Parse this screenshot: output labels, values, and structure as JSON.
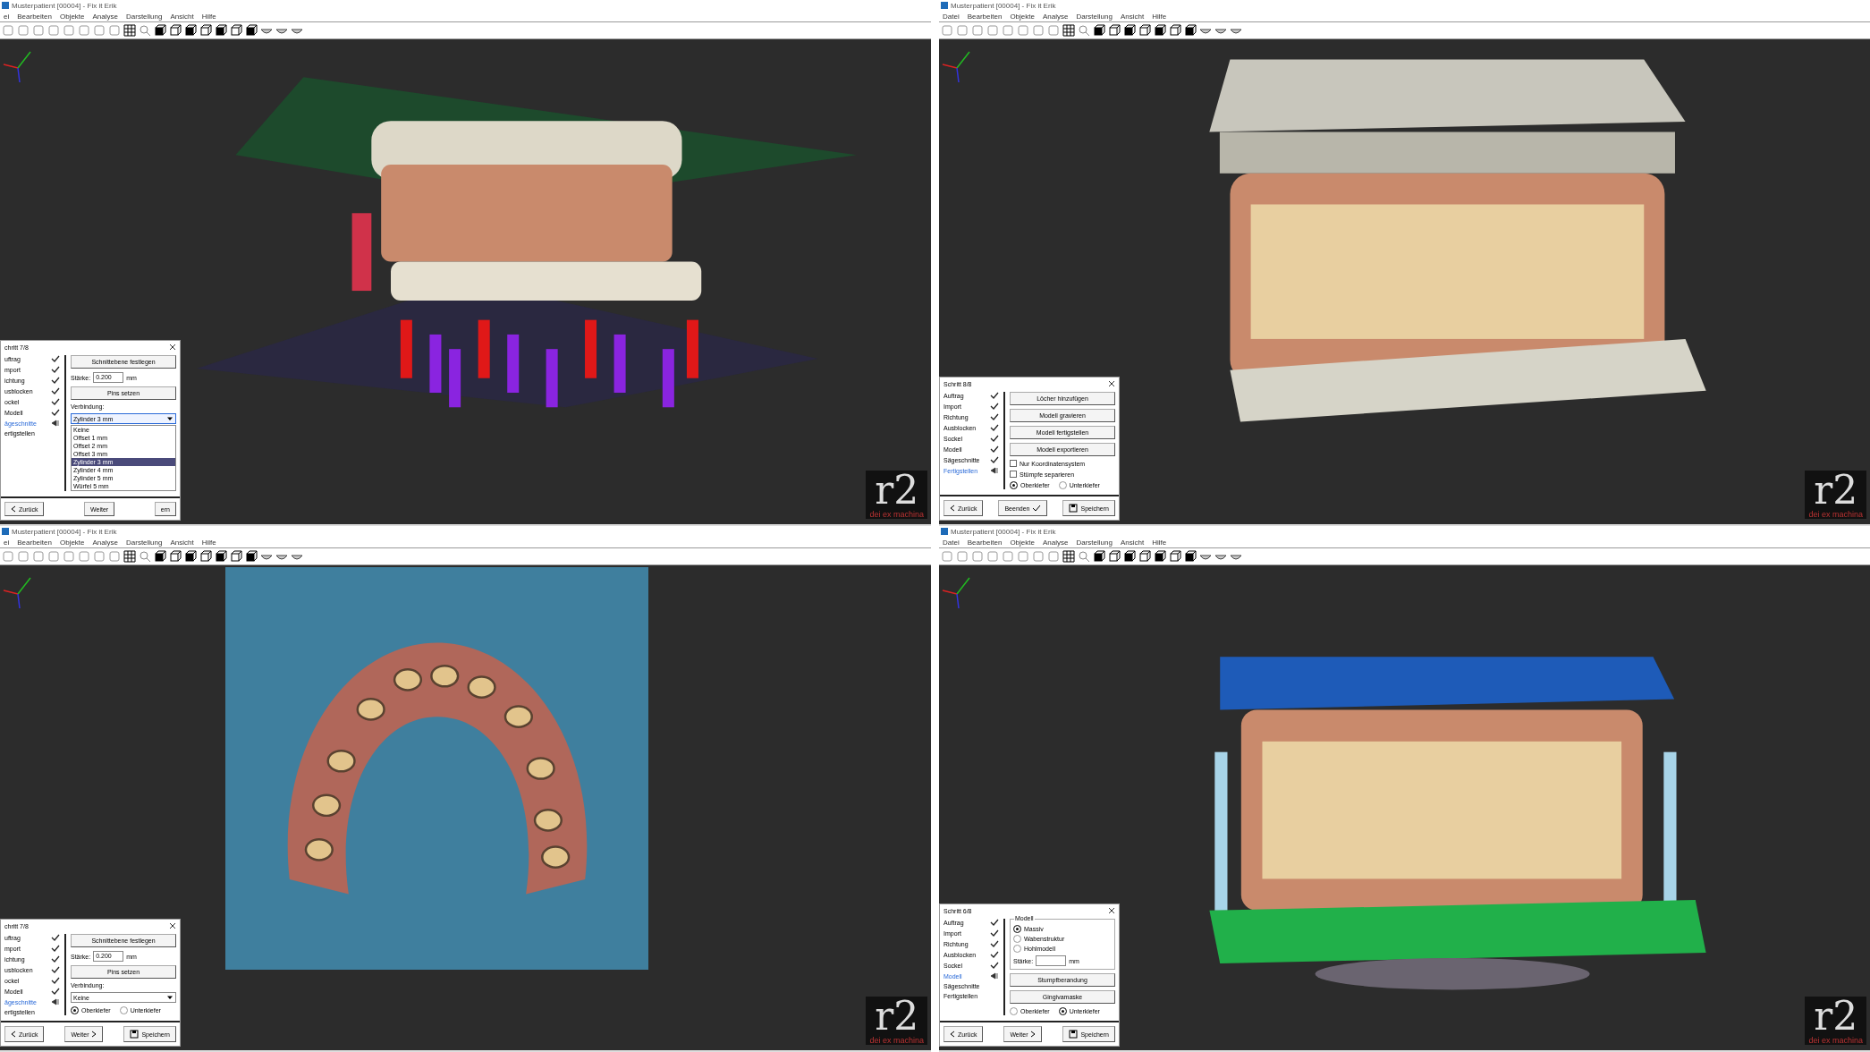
{
  "windows": [
    {
      "title": "Musterpatient [00004] - Fix it Erik",
      "menu": [
        "ei",
        "Bearbeiten",
        "Objekte",
        "Analyse",
        "Darstellung",
        "Ansicht",
        "Hilfe"
      ],
      "scene": {
        "kind": "cut-pins"
      },
      "logo": {
        "mark": "r2",
        "tagline": "dei ex machina"
      },
      "dialog": {
        "title": "chritt 7/8",
        "steps": [
          {
            "label": "uftrag",
            "done": true,
            "current": false
          },
          {
            "label": "mport",
            "done": true,
            "current": false
          },
          {
            "label": "ichtung",
            "done": true,
            "current": false
          },
          {
            "label": "usblocken",
            "done": true,
            "current": false
          },
          {
            "label": "ockel",
            "done": true,
            "current": false
          },
          {
            "label": "Modell",
            "done": true,
            "current": false
          },
          {
            "label": "ägeschnitte",
            "done": false,
            "current": true
          },
          {
            "label": "ertigstellen",
            "done": false,
            "current": false
          }
        ],
        "controls": [
          {
            "kind": "button",
            "label": "Schnittebene festlegen"
          },
          {
            "kind": "field",
            "label": "Stärke:",
            "value": "0.200",
            "unit": "mm"
          },
          {
            "kind": "button",
            "label": "Pins setzen"
          },
          {
            "kind": "text",
            "label": "Verbindung:"
          },
          {
            "kind": "dropdown",
            "value": "Zylinder 3 mm",
            "expanded": true,
            "options": [
              {
                "label": "Keine",
                "selected": false
              },
              {
                "label": "Offset 1 mm",
                "selected": false
              },
              {
                "label": "Offset 2 mm",
                "selected": false
              },
              {
                "label": "Offset 3 mm",
                "selected": false
              },
              {
                "label": "Zylinder 3 mm",
                "selected": true
              },
              {
                "label": "Zylinder 4 mm",
                "selected": false
              },
              {
                "label": "Zylinder 5 mm",
                "selected": false
              },
              {
                "label": "Würfel 5 mm",
                "selected": false
              }
            ]
          }
        ],
        "footer": [
          {
            "label": "Zurück",
            "kind": "back"
          },
          {
            "label": "Weiter",
            "kind": "plain"
          },
          {
            "label": "ern",
            "kind": "plain"
          }
        ]
      }
    },
    {
      "title": "Musterpatient [00004] - Fix it Erik",
      "menu": [
        "Datei",
        "Bearbeiten",
        "Objekte",
        "Analyse",
        "Darstellung",
        "Ansicht",
        "Hilfe"
      ],
      "scene": {
        "kind": "articulator-base"
      },
      "logo": {
        "mark": "r2",
        "tagline": "dei ex machina"
      },
      "dialog": {
        "title": "Schritt 8/8",
        "steps": [
          {
            "label": "Auftrag",
            "done": true,
            "current": false
          },
          {
            "label": "Import",
            "done": true,
            "current": false
          },
          {
            "label": "Richtung",
            "done": true,
            "current": false
          },
          {
            "label": "Ausblocken",
            "done": true,
            "current": false
          },
          {
            "label": "Sockel",
            "done": true,
            "current": false
          },
          {
            "label": "Modell",
            "done": true,
            "current": false
          },
          {
            "label": "Sägeschnitte",
            "done": true,
            "current": false
          },
          {
            "label": "Fertigstellen",
            "done": false,
            "current": true
          }
        ],
        "controls": [
          {
            "kind": "button",
            "label": "Löcher hinzufügen"
          },
          {
            "kind": "button",
            "label": "Modell gravieren"
          },
          {
            "kind": "button",
            "label": "Modell fertigstellen"
          },
          {
            "kind": "button",
            "label": "Modell exportieren"
          },
          {
            "kind": "checkbox",
            "label": "Nur Koordinatensystem",
            "checked": false
          },
          {
            "kind": "checkbox",
            "label": "Stümpfe separieren",
            "checked": false
          },
          {
            "kind": "radios",
            "options": [
              {
                "label": "Oberkiefer",
                "selected": true
              },
              {
                "label": "Unterkiefer",
                "selected": false
              }
            ]
          }
        ],
        "footer": [
          {
            "label": "Zurück",
            "kind": "back"
          },
          {
            "label": "Beenden",
            "kind": "finish"
          },
          {
            "label": "Speichern",
            "kind": "save"
          }
        ]
      }
    },
    {
      "title": "Musterpatient [00004] - Fix it Erik",
      "menu": [
        "ei",
        "Bearbeiten",
        "Objekte",
        "Analyse",
        "Darstellung",
        "Ansicht",
        "Hilfe"
      ],
      "scene": {
        "kind": "occlusal"
      },
      "logo": {
        "mark": "r2",
        "tagline": "dei ex machina"
      },
      "dialog": {
        "title": "chritt 7/8",
        "steps": [
          {
            "label": "uftrag",
            "done": true,
            "current": false
          },
          {
            "label": "mport",
            "done": true,
            "current": false
          },
          {
            "label": "ichtung",
            "done": true,
            "current": false
          },
          {
            "label": "usblocken",
            "done": true,
            "current": false
          },
          {
            "label": "ockel",
            "done": true,
            "current": false
          },
          {
            "label": "Modell",
            "done": true,
            "current": false
          },
          {
            "label": "ägeschnitte",
            "done": false,
            "current": true
          },
          {
            "label": "ertigstellen",
            "done": false,
            "current": false
          }
        ],
        "controls": [
          {
            "kind": "button",
            "label": "Schnittebene festlegen"
          },
          {
            "kind": "field",
            "label": "Stärke:",
            "value": "0.200",
            "unit": "mm"
          },
          {
            "kind": "button",
            "label": "Pins setzen"
          },
          {
            "kind": "text",
            "label": "Verbindung:"
          },
          {
            "kind": "dropdown",
            "value": "Keine",
            "expanded": false
          },
          {
            "kind": "radios",
            "options": [
              {
                "label": "Oberkiefer",
                "selected": true
              },
              {
                "label": "Unterkiefer",
                "selected": false
              }
            ]
          }
        ],
        "footer": [
          {
            "label": "Zurück",
            "kind": "back"
          },
          {
            "label": "Weiter",
            "kind": "next"
          },
          {
            "label": "Speichern",
            "kind": "save"
          }
        ]
      }
    },
    {
      "title": "Musterpatient [00004] - Fix it Erik",
      "menu": [
        "Datei",
        "Bearbeiten",
        "Objekte",
        "Analyse",
        "Darstellung",
        "Ansicht",
        "Hilfe"
      ],
      "scene": {
        "kind": "articulator-frame"
      },
      "logo": {
        "mark": "r2",
        "tagline": "dei ex machina"
      },
      "dialog": {
        "title": "Schritt 6/8",
        "steps": [
          {
            "label": "Auftrag",
            "done": true,
            "current": false
          },
          {
            "label": "Import",
            "done": true,
            "current": false
          },
          {
            "label": "Richtung",
            "done": true,
            "current": false
          },
          {
            "label": "Ausblocken",
            "done": true,
            "current": false
          },
          {
            "label": "Sockel",
            "done": true,
            "current": false
          },
          {
            "label": "Modell",
            "done": false,
            "current": true
          },
          {
            "label": "Sägeschnitte",
            "done": false,
            "current": false
          },
          {
            "label": "Fertigstellen",
            "done": false,
            "current": false
          }
        ],
        "controls": [
          {
            "kind": "group",
            "title": "Modell",
            "children": [
              {
                "kind": "radios",
                "options": [
                  {
                    "label": "Massiv",
                    "selected": true
                  },
                  {
                    "label": "Wabenstruktur",
                    "selected": false
                  },
                  {
                    "label": "Hohlmodell",
                    "selected": false
                  }
                ]
              },
              {
                "kind": "field",
                "label": "Stärke:",
                "unit": "mm"
              }
            ]
          },
          {
            "kind": "button",
            "label": "Stumpfberandung"
          },
          {
            "kind": "button",
            "label": "Gingivamaske"
          },
          {
            "kind": "radios",
            "options": [
              {
                "label": "Oberkiefer",
                "selected": false
              },
              {
                "label": "Unterkiefer",
                "selected": true
              }
            ]
          }
        ],
        "footer": [
          {
            "label": "Zurück",
            "kind": "back"
          },
          {
            "label": "Weiter",
            "kind": "next"
          },
          {
            "label": "Speichern",
            "kind": "save"
          }
        ]
      }
    }
  ]
}
